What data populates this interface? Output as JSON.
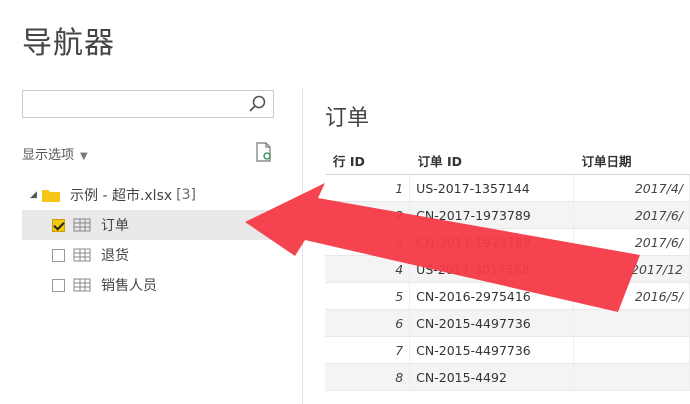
{
  "title": "导航器",
  "search": {
    "value": "",
    "placeholder": ""
  },
  "display_options": "显示选项",
  "tree": {
    "root": {
      "label": "示例 - 超市.xlsx",
      "count": "[3]"
    },
    "items": [
      {
        "label": "订单",
        "checked": true
      },
      {
        "label": "退货",
        "checked": false
      },
      {
        "label": "销售人员",
        "checked": false
      }
    ]
  },
  "preview": {
    "title": "订单",
    "columns": [
      "行 ID",
      "订单 ID",
      "订单日期"
    ],
    "rows": [
      [
        "1",
        "US-2017-1357144",
        "2017/4/"
      ],
      [
        "2",
        "CN-2017-1973789",
        "2017/6/"
      ],
      [
        "3",
        "CN-2017-1973789",
        "2017/6/"
      ],
      [
        "4",
        "US-2017-3017568",
        "2017/12"
      ],
      [
        "5",
        "CN-2016-2975416",
        "2016/5/"
      ],
      [
        "6",
        "CN-2015-4497736",
        ""
      ],
      [
        "7",
        "CN-2015-4497736",
        ""
      ],
      [
        "8",
        "CN-2015-4492",
        ""
      ]
    ]
  },
  "colors": {
    "arrow": "#f43a46",
    "checkbox": "#f2c811",
    "folder": "#f5c518"
  },
  "icons": [
    "search-icon",
    "refresh-icon",
    "folder-icon",
    "table-icon",
    "arrow-pointer"
  ]
}
